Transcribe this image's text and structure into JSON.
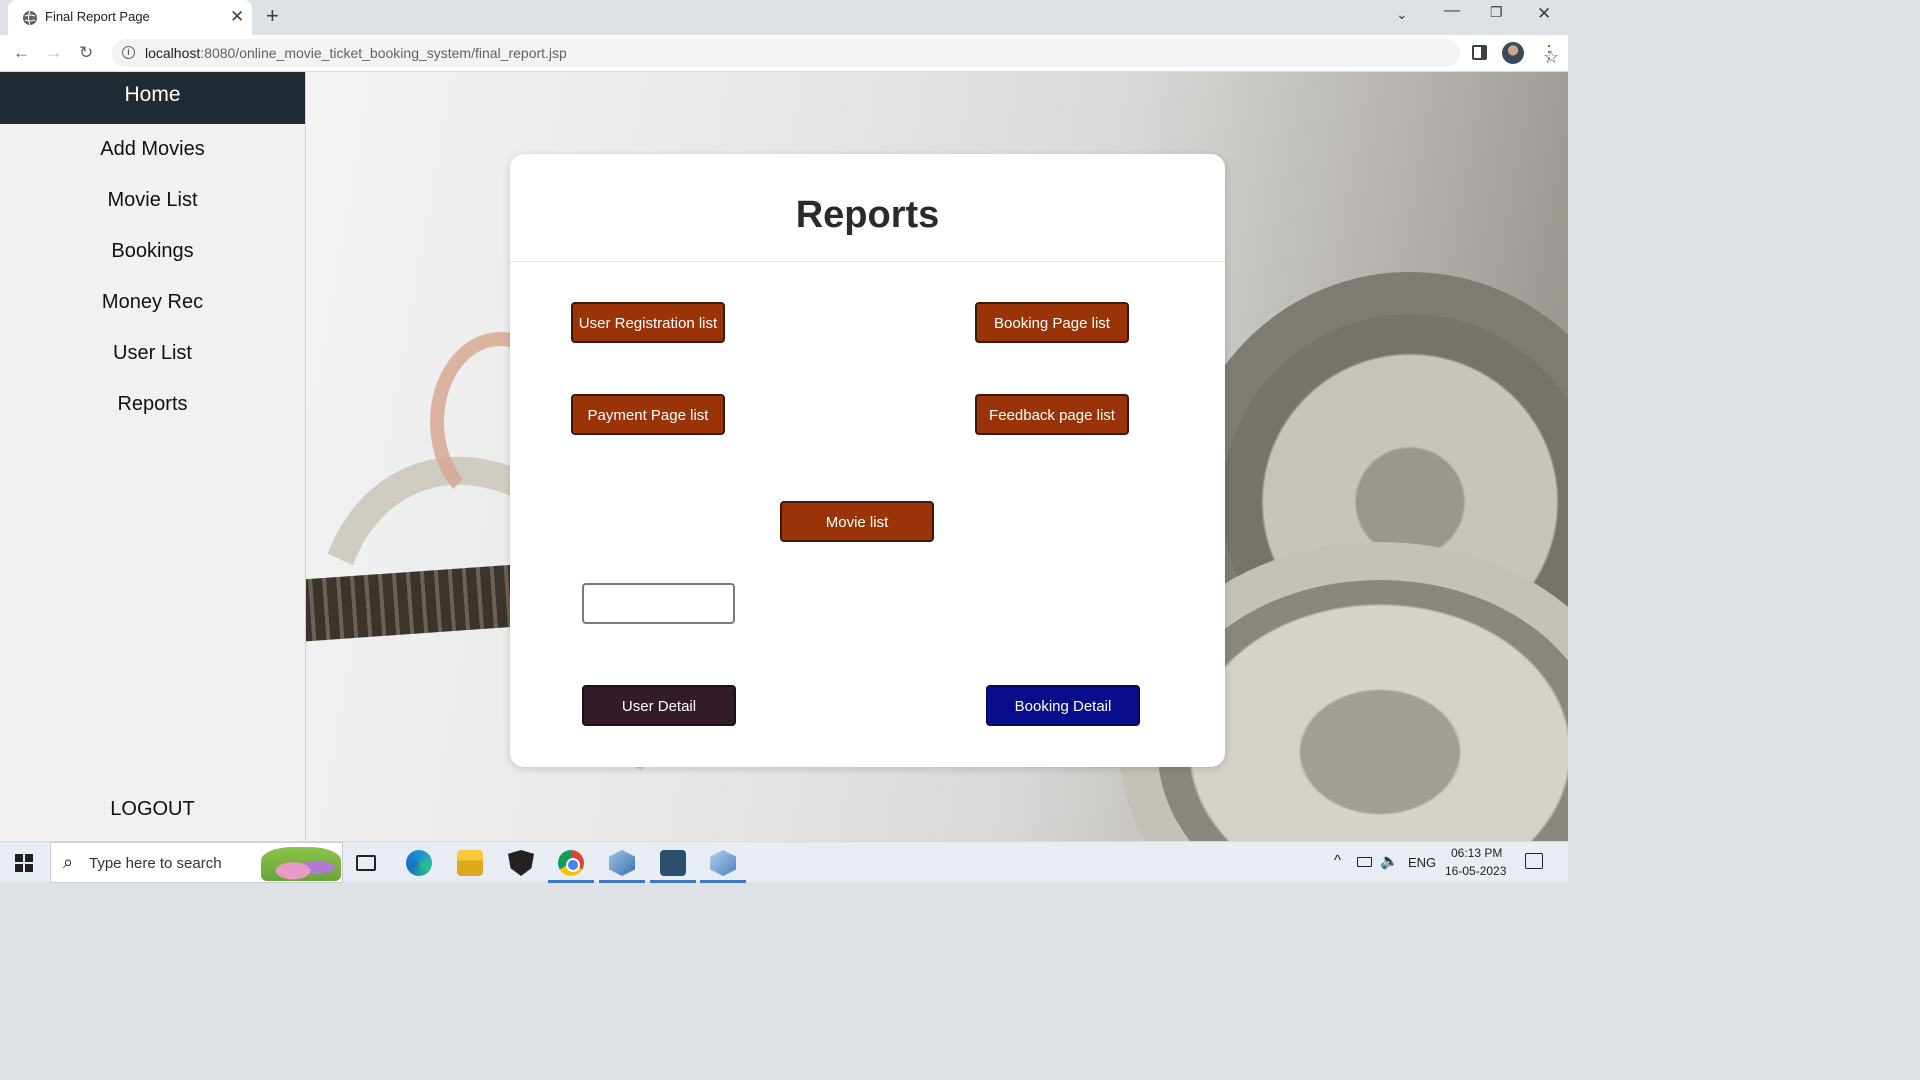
{
  "browser": {
    "tab_title": "Final Report Page",
    "url_host": "localhost",
    "url_rest": ":8080/online_movie_ticket_booking_system/final_report.jsp"
  },
  "sidebar": {
    "items": [
      {
        "label": "Home",
        "active": true
      },
      {
        "label": "Add Movies"
      },
      {
        "label": "Movie List"
      },
      {
        "label": "Bookings"
      },
      {
        "label": "Money Rec"
      },
      {
        "label": "User List"
      },
      {
        "label": "Reports"
      }
    ],
    "logout": "LOGOUT"
  },
  "report": {
    "title": "Reports",
    "buttons": {
      "user_registration": "User Registration list",
      "booking_page": "Booking Page list",
      "payment_page": "Payment Page list",
      "feedback_page": "Feedback page list",
      "movie_list": "Movie list",
      "user_detail": "User Detail",
      "booking_detail": "Booking Detail"
    },
    "input_value": ""
  },
  "taskbar": {
    "search_placeholder": "Type here to search",
    "language": "ENG",
    "time": "06:13 PM",
    "date": "16-05-2023"
  },
  "colors": {
    "brown_button": "#9a3408",
    "user_detail_button": "#341b29",
    "booking_detail_button": "#070d8b",
    "sidebar_active": "#1f2a33"
  }
}
